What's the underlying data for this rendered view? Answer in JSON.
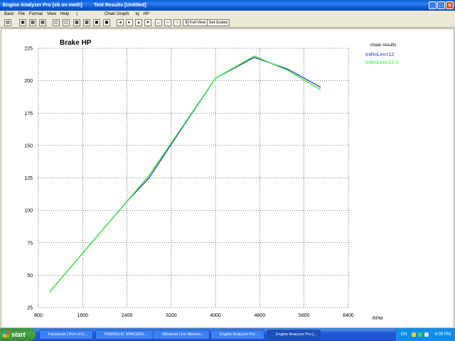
{
  "window": {
    "title_app": "Engine Analyzer Pro [eb on meth]",
    "title_doc": "Test Results [Untitled]"
  },
  "menu": {
    "items": [
      "Back",
      "File",
      "Format",
      "View",
      "Help"
    ],
    "separator": "|",
    "chain_graph_label": "Chain Graph:",
    "chain_graph_value": "tq",
    "chain_graph_mode": "HP"
  },
  "toolbar": {
    "full_view": "Full View",
    "set_scales": "Set Scales"
  },
  "chart_data": {
    "type": "line",
    "title": "Brake HP",
    "xlabel": "RPM",
    "ylabel": "",
    "xlim": [
      800,
      6400
    ],
    "ylim": [
      25,
      225
    ],
    "xticks": [
      800,
      1600,
      2400,
      3200,
      4000,
      4800,
      5600,
      6400
    ],
    "yticks": [
      25,
      50,
      75,
      100,
      125,
      150,
      175,
      200,
      225
    ],
    "grid": true,
    "legend_title": "chain results",
    "legend_position": "top-right",
    "series": [
      {
        "name": "IntRnLen=12",
        "color": "#3333cc",
        "points": [
          [
            1000,
            37
          ],
          [
            2400,
            107
          ],
          [
            2800,
            125
          ],
          [
            3200,
            151
          ],
          [
            4000,
            202
          ],
          [
            4700,
            218
          ],
          [
            5300,
            209
          ],
          [
            5900,
            195
          ]
        ]
      },
      {
        "name": "IntRnLen=12.5",
        "color": "#33ee33",
        "points": [
          [
            1000,
            37
          ],
          [
            2400,
            107
          ],
          [
            2800,
            127
          ],
          [
            3200,
            152
          ],
          [
            4000,
            202
          ],
          [
            4700,
            219
          ],
          [
            5300,
            208
          ],
          [
            5900,
            193
          ]
        ]
      }
    ]
  },
  "taskbar": {
    "start_label": "start",
    "tasks": [
      {
        "label": "Facebook | Port of C...",
        "color": "#e06a1a"
      },
      {
        "label": "PHENOLIC SPACERS ...",
        "color": "#e06a1a"
      },
      {
        "label": "Windows Live Messen...",
        "color": "#2aa52a"
      },
      {
        "label": "Engine Analyzer Pro ...",
        "color": "#d0d0d0"
      },
      {
        "label": "Engine Analyzer Pro [...",
        "color": "#d0d0d0"
      }
    ],
    "language": "EN",
    "clock": "6:09 PM"
  }
}
